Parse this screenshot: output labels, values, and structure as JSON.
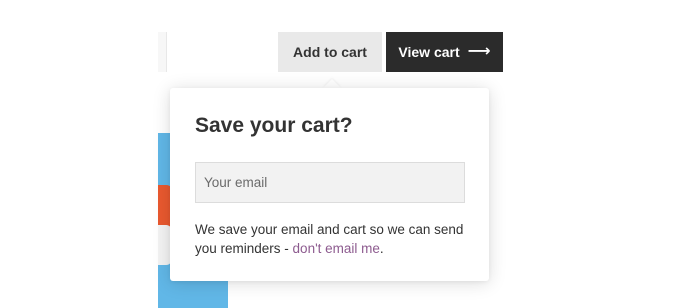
{
  "buttons": {
    "add_to_cart": "Add to cart",
    "view_cart": "View cart",
    "view_cart_arrow": "⟶"
  },
  "popup": {
    "title": "Save your cart?",
    "email_placeholder": "Your email",
    "note_before_link": "We save your email and cart so we can send you reminders - ",
    "link_text": "don't email me",
    "note_after_link": "."
  },
  "colors": {
    "add_button_bg": "#e9e9e9",
    "view_button_bg": "#2b2b2b",
    "link": "#8d5b8f",
    "product_image_bg": "#61b7e7"
  },
  "icons": {
    "view_cart_arrow": "arrow-right-icon"
  }
}
